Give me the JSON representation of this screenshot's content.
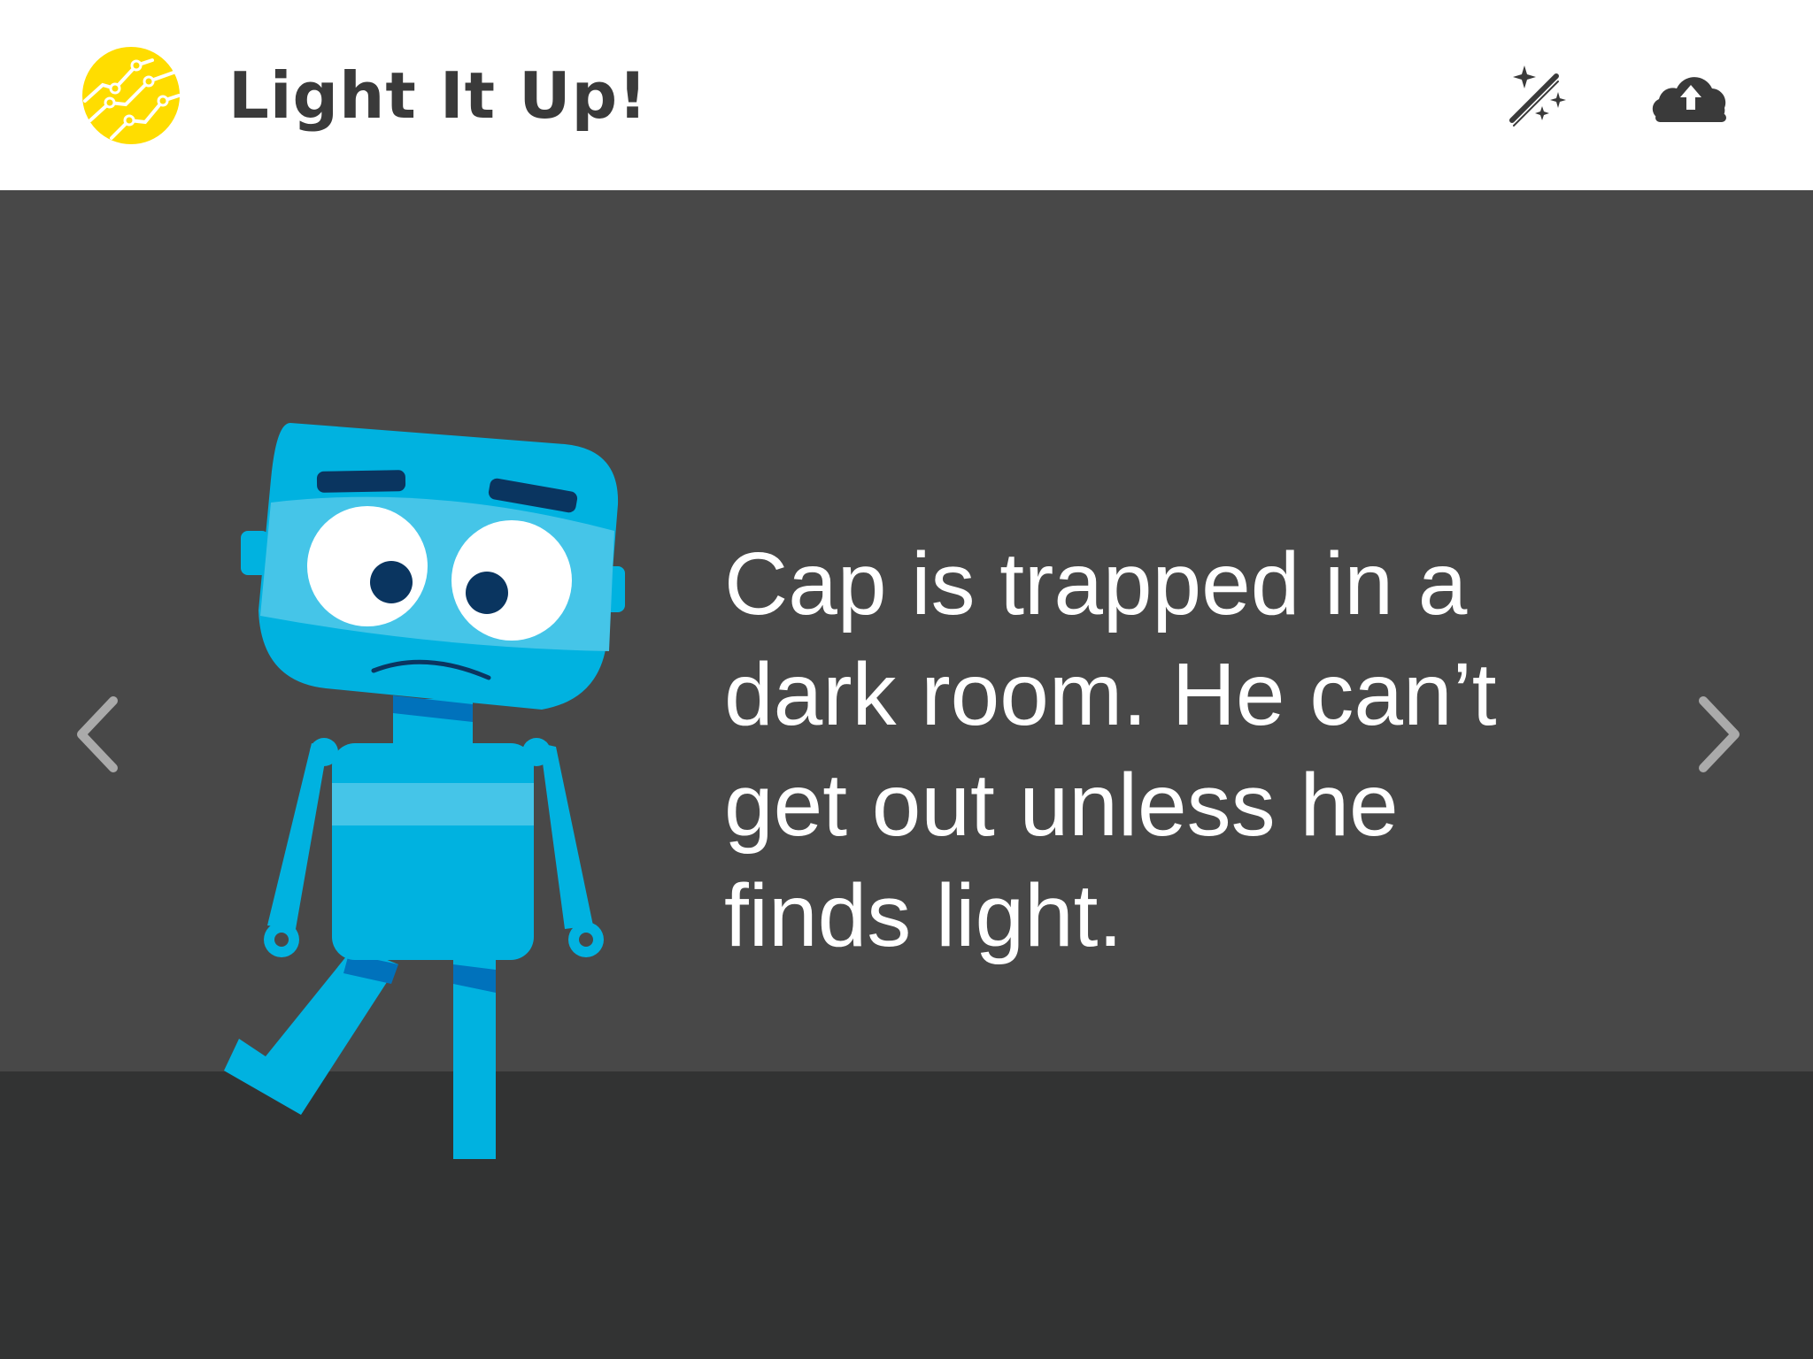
{
  "app": {
    "title": "Light It Up!"
  },
  "header": {
    "logo_icon": "circuit-logo-icon",
    "magic_wand_icon": "magic-wand-icon",
    "cloud_upload_icon": "cloud-upload-icon"
  },
  "story": {
    "text": "Cap is trapped in a dark room. He can’t get out unless he finds light.",
    "character": "Cap"
  },
  "navigation": {
    "prev_icon": "chevron-left-icon",
    "next_icon": "chevron-right-icon"
  },
  "colors": {
    "logo_yellow": "#FFDD00",
    "header_text": "#3A3A3A",
    "room_wall": "#484848",
    "room_floor": "#323333",
    "robot_blue": "#00B2E0",
    "robot_light_blue": "#45C5E8",
    "robot_dark_blue": "#0072BC",
    "eyebrow_navy": "#0A3560",
    "nav_gray": "#AAAAAA"
  }
}
